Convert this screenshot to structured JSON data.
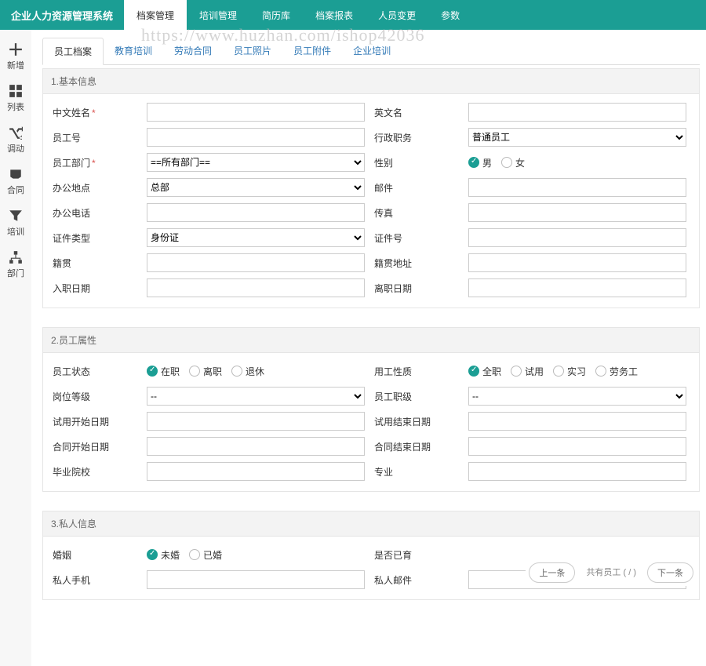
{
  "brand": "企业人力资源管理系统",
  "topnav": [
    "档案管理",
    "培训管理",
    "简历库",
    "档案报表",
    "人员变更",
    "参数"
  ],
  "topnav_active": 0,
  "sidebar": [
    {
      "label": "新增"
    },
    {
      "label": "列表"
    },
    {
      "label": "调动"
    },
    {
      "label": "合同"
    },
    {
      "label": "培训"
    },
    {
      "label": "部门"
    }
  ],
  "tabs": [
    "员工档案",
    "教育培训",
    "劳动合同",
    "员工照片",
    "员工附件",
    "企业培训"
  ],
  "tabs_active": 0,
  "watermark": "https://www.huzhan.com/ishop42036",
  "sections": {
    "s1": {
      "title": "1.基本信息",
      "chinese_name_label": "中文姓名",
      "english_name_label": "英文名",
      "emp_no_label": "员工号",
      "admin_post_label": "行政职务",
      "admin_post_value": "普通员工",
      "dept_label": "员工部门",
      "dept_value": "==所有部门==",
      "gender_label": "性别",
      "gender_opts": [
        "男",
        "女"
      ],
      "gender_sel": 0,
      "office_loc_label": "办公地点",
      "office_loc_value": "总部",
      "email_label": "邮件",
      "office_tel_label": "办公电话",
      "fax_label": "传真",
      "id_type_label": "证件类型",
      "id_type_value": "身份证",
      "id_no_label": "证件号",
      "native_label": "籍贯",
      "native_addr_label": "籍贯地址",
      "hire_date_label": "入职日期",
      "leave_date_label": "离职日期"
    },
    "s2": {
      "title": "2.员工属性",
      "status_label": "员工状态",
      "status_opts": [
        "在职",
        "离职",
        "退休"
      ],
      "status_sel": 0,
      "work_nature_label": "用工性质",
      "work_nature_opts": [
        "全职",
        "试用",
        "实习",
        "劳务工"
      ],
      "work_nature_sel": 0,
      "post_level_label": "岗位等级",
      "post_level_value": "--",
      "emp_level_label": "员工职级",
      "emp_level_value": "--",
      "trial_start_label": "试用开始日期",
      "trial_end_label": "试用结束日期",
      "contract_start_label": "合同开始日期",
      "contract_end_label": "合同结束日期",
      "school_label": "毕业院校",
      "major_label": "专业"
    },
    "s3": {
      "title": "3.私人信息",
      "marriage_label": "婚姻",
      "marriage_opts": [
        "未婚",
        "已婚"
      ],
      "marriage_sel": 0,
      "has_child_label": "是否已育",
      "personal_mobile_label": "私人手机",
      "personal_email_label": "私人邮件"
    }
  },
  "footer": {
    "prev": "上一条",
    "summary": "共有员工 ( / )",
    "next": "下一条"
  }
}
